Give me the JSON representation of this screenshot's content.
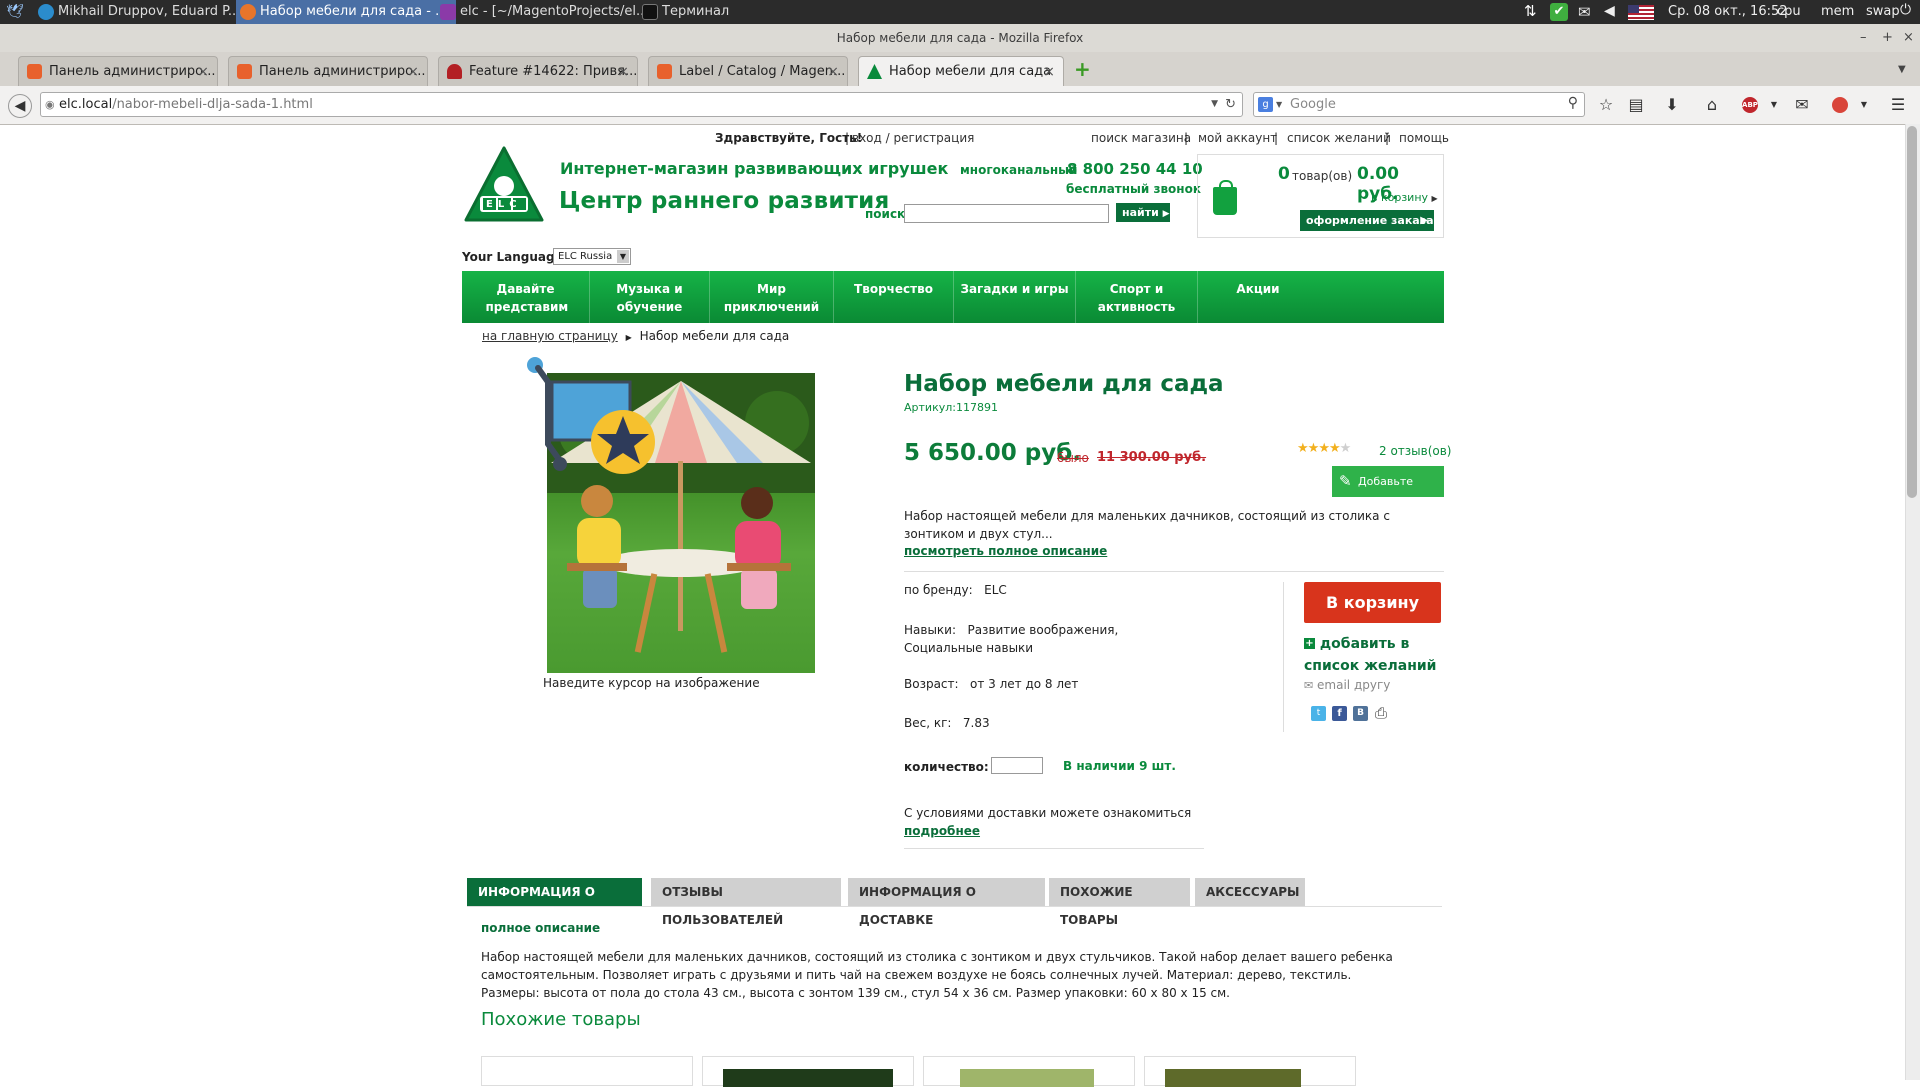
{
  "os": {
    "tasks": [
      {
        "label": "Mikhail Druppov, Eduard P...",
        "active": false
      },
      {
        "label": "Набор мебели для сада - ...",
        "active": true
      },
      {
        "label": "elc - [~/MagentoProjects/el...",
        "active": false
      },
      {
        "label": "Терминал",
        "active": false
      }
    ],
    "clock": "Ср. 08 окт., 16:52",
    "cpu": "cpu",
    "mem": "mem",
    "swap": "swap"
  },
  "browser": {
    "window_title": "Набор мебели для сада - Mozilla Firefox",
    "tabs": [
      {
        "label": "Панель администриро...",
        "active": false
      },
      {
        "label": "Панель администриро...",
        "active": false
      },
      {
        "label": "Feature #14622: Привя...",
        "active": false
      },
      {
        "label": "Label / Catalog / Magen...",
        "active": false
      },
      {
        "label": "Набор мебели для сада",
        "active": true
      }
    ],
    "url_host": "elc.local",
    "url_path": "/nabor-mebeli-dlja-sada-1.html",
    "search_placeholder": "Google"
  },
  "header": {
    "greeting": "Здравствуйте, Гость!",
    "login_link": "вход / регистрация",
    "top_links": [
      "поиск магазина",
      "мой аккаунт",
      "список желаний",
      "помощь"
    ],
    "logo_text": "ELC",
    "tagline": "Интернет-магазин развивающих игрушек",
    "site_title": "Центр раннего развития",
    "phone_label": "многоканальный",
    "phone": "8 800 250 44 10",
    "phone_sub": "бесплатный звонок",
    "search_label": "поиск",
    "search_button": "найти",
    "cart_count": "0",
    "cart_items_label": "товар(ов)",
    "cart_total": "0.00 руб.",
    "cart_link": "в корзину",
    "checkout_button": "оформление заказа",
    "language_label": "Your Language:",
    "language_value": "ELC Russia"
  },
  "menu": [
    "Давайте представим",
    "Музыка и обучение",
    "Мир приключений",
    "Творчество",
    "Загадки и игры",
    "Спорт и активность",
    "Акции"
  ],
  "breadcrumb": {
    "home": "на главную страницу",
    "current": "Набор мебели для сада"
  },
  "product": {
    "title": "Набор мебели для сада",
    "sku": "Артикул:117891",
    "price": "5 650.00 руб.",
    "was_label": "было",
    "old_price": "11 300.00 руб.",
    "rating": 4,
    "rating_max": 5,
    "reviews": "2 отзыв(ов)",
    "add_review": "Добавьте отзыв",
    "short_desc": "Набор настоящей мебели для маленьких дачников, состоящий из столика с зонтиком и двух стул...",
    "more_link": "посмотреть полное описание",
    "image_hint": "Наведите курсор на изображение",
    "attrs": [
      {
        "label": "по бренду:",
        "value": "ELC"
      },
      {
        "label": "Навыки:",
        "value": "Развитие воображения, Социальные навыки"
      },
      {
        "label": "Возраст:",
        "value": "от 3 лет до 8 лет"
      },
      {
        "label": "Вес, кг:",
        "value": "7.83"
      }
    ],
    "qty_label": "количество:",
    "qty_value": "",
    "stock": "В наличии 9 шт.",
    "delivery_text": "С условиями доставки можете ознакомиться",
    "delivery_link": "подробнее",
    "add_to_cart": "В корзину",
    "wishlist": "добавить в список желаний",
    "email_friend": "email другу"
  },
  "info_tabs": [
    "ИНФОРМАЦИЯ О ТОВАРЕ",
    "ОТЗЫВЫ ПОЛЬЗОВАТЕЛЕЙ",
    "ИНФОРМАЦИЯ О ДОСТАВКЕ",
    "ПОХОЖИЕ ТОВАРЫ",
    "АКСЕССУАРЫ"
  ],
  "description": {
    "heading": "полное описание",
    "text": "Набор настоящей мебели для маленьких дачников, состоящий из столика с зонтиком и двух стульчиков. Такой набор делает вашего ребенка самостоятельным. Позволяет играть с друзьями и пить чай на свежем воздухе не боясь солнечных лучей. Материал: дерево, текстиль. Размеры: высота от пола до стола 43 см., высота с зонтом 139 см., стул 54 х 36 см. Размер упаковки: 60 х 80 х 15 см."
  },
  "similar": {
    "heading": "Похожие товары"
  },
  "colors": {
    "brand_green": "#0a8a3c",
    "menu_green": "#12a13f",
    "price_green": "#0d7c3a",
    "cart_red": "#d8341c",
    "old_price_red": "#c0262c"
  }
}
